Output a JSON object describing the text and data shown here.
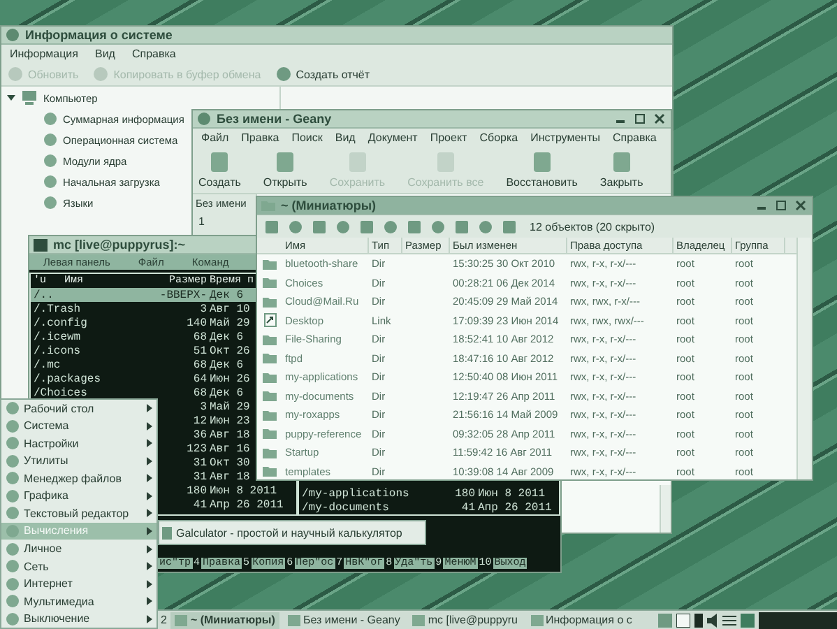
{
  "sysinfo_window": {
    "title": "Информация о системе",
    "menu": [
      "Информация",
      "Вид",
      "Справка"
    ],
    "toolbar": [
      {
        "label": "Обновить",
        "disabled": true
      },
      {
        "label": "Копировать в буфер обмена",
        "disabled": true
      },
      {
        "label": "Создать отчёт",
        "disabled": false
      }
    ],
    "tree": [
      {
        "label": "Компьютер",
        "expanded": true,
        "children": [
          {
            "label": "Суммарная информация"
          },
          {
            "label": "Операционная система"
          },
          {
            "label": "Модули ядра"
          },
          {
            "label": "Начальная загрузка"
          },
          {
            "label": "Языки"
          }
        ]
      }
    ]
  },
  "geany_window": {
    "title": "Без имени - Geany",
    "menu": [
      "Файл",
      "Правка",
      "Поиск",
      "Вид",
      "Документ",
      "Проект",
      "Сборка",
      "Инструменты",
      "Справка"
    ],
    "toolbar": [
      {
        "label": "Создать",
        "disabled": false
      },
      {
        "label": "Открыть",
        "disabled": false
      },
      {
        "label": "Сохранить",
        "disabled": true
      },
      {
        "label": "Сохранить все",
        "disabled": true
      },
      {
        "label": "Восстановить",
        "disabled": false
      },
      {
        "label": "Закрыть",
        "disabled": false
      }
    ],
    "document_tab": "Без имени",
    "line_number": "1"
  },
  "mc_window": {
    "title": "mc [live@puppyrus]:~",
    "menu": [
      "Левая панель",
      "Файл",
      "Команд"
    ],
    "columns": [
      "'u",
      "Имя",
      "Размер",
      "Время п"
    ],
    "left_rows": [
      {
        "name": "/..",
        "size": "-ВВЕРХ-",
        "time": "Дек 6",
        "selected": true
      },
      {
        "name": "/.Trash",
        "size": "3",
        "time": "Авг 10",
        "selected": false
      },
      {
        "name": "/.config",
        "size": "140",
        "time": "Май 29",
        "selected": false
      },
      {
        "name": "/.icewm",
        "size": "68",
        "time": "Дек 6",
        "selected": false
      },
      {
        "name": "/.icons",
        "size": "51",
        "time": "Окт 26",
        "selected": false
      },
      {
        "name": "/.mc",
        "size": "68",
        "time": "Дек 6",
        "selected": false
      },
      {
        "name": "/.packages",
        "size": "64",
        "time": "Июн 26",
        "selected": false
      },
      {
        "name": "/Choices",
        "size": "68",
        "time": "Дек 6",
        "selected": false
      },
      {
        "size": "3",
        "time": "Май 29",
        "selected": false
      },
      {
        "size": "12",
        "time": "Июн 23",
        "selected": false
      },
      {
        "size": "36",
        "time": "Авг 18",
        "selected": false
      },
      {
        "size": "123",
        "time": "Авг 16",
        "selected": false
      },
      {
        "size": "31",
        "time": "Окт 30",
        "selected": false
      },
      {
        "size": "31",
        "time": "Авг 18",
        "selected": false
      },
      {
        "size": "180",
        "time": "Июн 8 2011",
        "selected": false
      },
      {
        "size": "41",
        "time": "Апр 26 2011",
        "selected": false
      }
    ],
    "right_rows": [
      {
        "name": "/my-applications",
        "size": "180",
        "time": "Июн 8 2011",
        "selected": false
      },
      {
        "name": "/my-documents",
        "size": "41",
        "time": "Апр 26 2011",
        "selected": false
      }
    ],
    "function_keys": [
      {
        "label": "ис\"тр"
      },
      {
        "num": "4",
        "label": "Правка"
      },
      {
        "num": "5",
        "label": "Копия"
      },
      {
        "num": "6",
        "label": "Пер\"ос"
      },
      {
        "num": "7",
        "label": "НвК\"ог"
      },
      {
        "num": "8",
        "label": "Уда\"ть"
      },
      {
        "num": "9",
        "label": "МенюМ"
      },
      {
        "num": "10",
        "label": "Выход"
      }
    ]
  },
  "file_manager_window": {
    "title": "~ (Миниатюры)",
    "status": "12 объектов (20 скрыто)",
    "columns": [
      "Имя",
      "Тип",
      "Размер",
      "Был изменен",
      "Права доступа",
      "Владелец",
      "Группа"
    ],
    "rows": [
      {
        "kind": "dir",
        "name": "bluetooth-share",
        "type": "Dir",
        "modified": "15:30:25 30 Окт 2010",
        "permissions": "rwx, r-x, r-x/---",
        "owner": "root",
        "group": "root"
      },
      {
        "kind": "dir",
        "name": "Choices",
        "type": "Dir",
        "modified": "00:28:21 06 Дек 2014",
        "permissions": "rwx, r-x, r-x/---",
        "owner": "root",
        "group": "root"
      },
      {
        "kind": "dir",
        "name": "Cloud@Mail.Ru",
        "type": "Dir",
        "modified": "20:45:09 29 Май 2014",
        "permissions": "rwx, rwx, r-x/---",
        "owner": "root",
        "group": "root"
      },
      {
        "kind": "link",
        "name": "Desktop",
        "type": "Link",
        "modified": "17:09:39 23 Июн 2014",
        "permissions": "rwx, rwx, rwx/---",
        "owner": "root",
        "group": "root"
      },
      {
        "kind": "dir",
        "name": "File-Sharing",
        "type": "Dir",
        "modified": "18:52:41 10 Авг 2012",
        "permissions": "rwx, r-x, r-x/---",
        "owner": "root",
        "group": "root"
      },
      {
        "kind": "dir",
        "name": "ftpd",
        "type": "Dir",
        "modified": "18:47:16 10 Авг 2012",
        "permissions": "rwx, r-x, r-x/---",
        "owner": "root",
        "group": "root"
      },
      {
        "kind": "dir",
        "name": "my-applications",
        "type": "Dir",
        "modified": "12:50:40 08 Июн 2011",
        "permissions": "rwx, r-x, r-x/---",
        "owner": "root",
        "group": "root"
      },
      {
        "kind": "dir",
        "name": "my-documents",
        "type": "Dir",
        "modified": "12:19:47 26 Апр 2011",
        "permissions": "rwx, r-x, r-x/---",
        "owner": "root",
        "group": "root"
      },
      {
        "kind": "dir",
        "name": "my-roxapps",
        "type": "Dir",
        "modified": "21:56:16 14 Май 2009",
        "permissions": "rwx, r-x, r-x/---",
        "owner": "root",
        "group": "root"
      },
      {
        "kind": "dir",
        "name": "puppy-reference",
        "type": "Dir",
        "modified": "09:32:05 28 Апр 2011",
        "permissions": "rwx, r-x, r-x/---",
        "owner": "root",
        "group": "root"
      },
      {
        "kind": "dir",
        "name": "Startup",
        "type": "Dir",
        "modified": "11:59:42 16 Авг 2011",
        "permissions": "rwx, r-x, r-x/---",
        "owner": "root",
        "group": "root"
      },
      {
        "kind": "dir",
        "name": "templates",
        "type": "Dir",
        "modified": "10:39:08 14 Авг 2009",
        "permissions": "rwx, r-x, r-x/---",
        "owner": "root",
        "group": "root"
      }
    ]
  },
  "start_menu": {
    "items": [
      {
        "label": "Рабочий стол",
        "selected": false
      },
      {
        "label": "Система",
        "selected": false
      },
      {
        "label": "Настройки",
        "selected": false
      },
      {
        "label": "Утилиты",
        "selected": false
      },
      {
        "label": "Менеджер файлов",
        "selected": false
      },
      {
        "label": "Графика",
        "selected": false
      },
      {
        "label": "Текстовый редактор",
        "selected": false
      },
      {
        "label": "Вычисления",
        "selected": true
      },
      {
        "label": "Личное",
        "selected": false
      },
      {
        "label": "Сеть",
        "selected": false
      },
      {
        "label": "Интернет",
        "selected": false
      },
      {
        "label": "Мультимедиа",
        "selected": false
      },
      {
        "label": "Выключение",
        "selected": false
      }
    ],
    "submenu": [
      {
        "label": "Galculator - простой и научный калькулятор"
      }
    ]
  },
  "taskbar": {
    "workspace": "2",
    "tasks": [
      {
        "label": "~ (Миниатюры)",
        "selected": true
      },
      {
        "label": "Без имени - Geany",
        "selected": false
      },
      {
        "label": "mc [live@puppyru",
        "selected": false
      },
      {
        "label": "Информация о с",
        "selected": false
      }
    ]
  }
}
